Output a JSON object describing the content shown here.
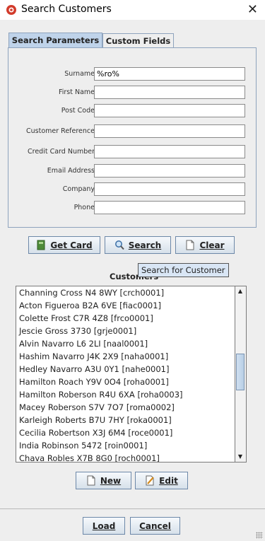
{
  "window": {
    "title": "Search Customers"
  },
  "tabs": [
    {
      "label": "Search Parameters"
    },
    {
      "label": "Custom Fields"
    }
  ],
  "form": {
    "fields": [
      {
        "label": "Surname",
        "value": "%ro%"
      },
      {
        "label": "First Name",
        "value": ""
      },
      {
        "label": "Post Code",
        "value": ""
      },
      {
        "label": "Customer Reference",
        "value": ""
      },
      {
        "label": "Credit Card Number",
        "value": ""
      },
      {
        "label": "Email Address",
        "value": ""
      },
      {
        "label": "Company",
        "value": ""
      },
      {
        "label": "Phone",
        "value": ""
      }
    ]
  },
  "actions": {
    "get_card": "Get Card",
    "search": "Search",
    "clear": "Clear",
    "search_tooltip": "Search for Customer"
  },
  "customers": {
    "label": "Customers",
    "items": [
      "Channing Cross N4 8WY [crch0001]",
      "Acton Figueroa B2A 6VE [fiac0001]",
      "Colette Frost C7R 4Z8 [frco0001]",
      "Jescie Gross 3730 [grje0001]",
      "Alvin Navarro L6 2LI [naal0001]",
      "Hashim Navarro J4K 2X9 [naha0001]",
      "Hedley Navarro A3U 0Y1 [nahe0001]",
      "Hamilton Roach Y9V 0O4 [roha0001]",
      "Hamilton Roberson R4U 6XA [roha0003]",
      "Macey Roberson S7V 7O7 [roma0002]",
      "Karleigh Roberts B7U 7HY [roka0001]",
      "Cecilia Robertson X3J 6M4 [roce0001]",
      "India Robinson 5472 [roin0001]",
      "Chava Robles X7B 8G0 [roch0001]"
    ]
  },
  "list_actions": {
    "new": "New",
    "edit": "Edit"
  },
  "footer": {
    "load": "Load",
    "cancel": "Cancel"
  }
}
